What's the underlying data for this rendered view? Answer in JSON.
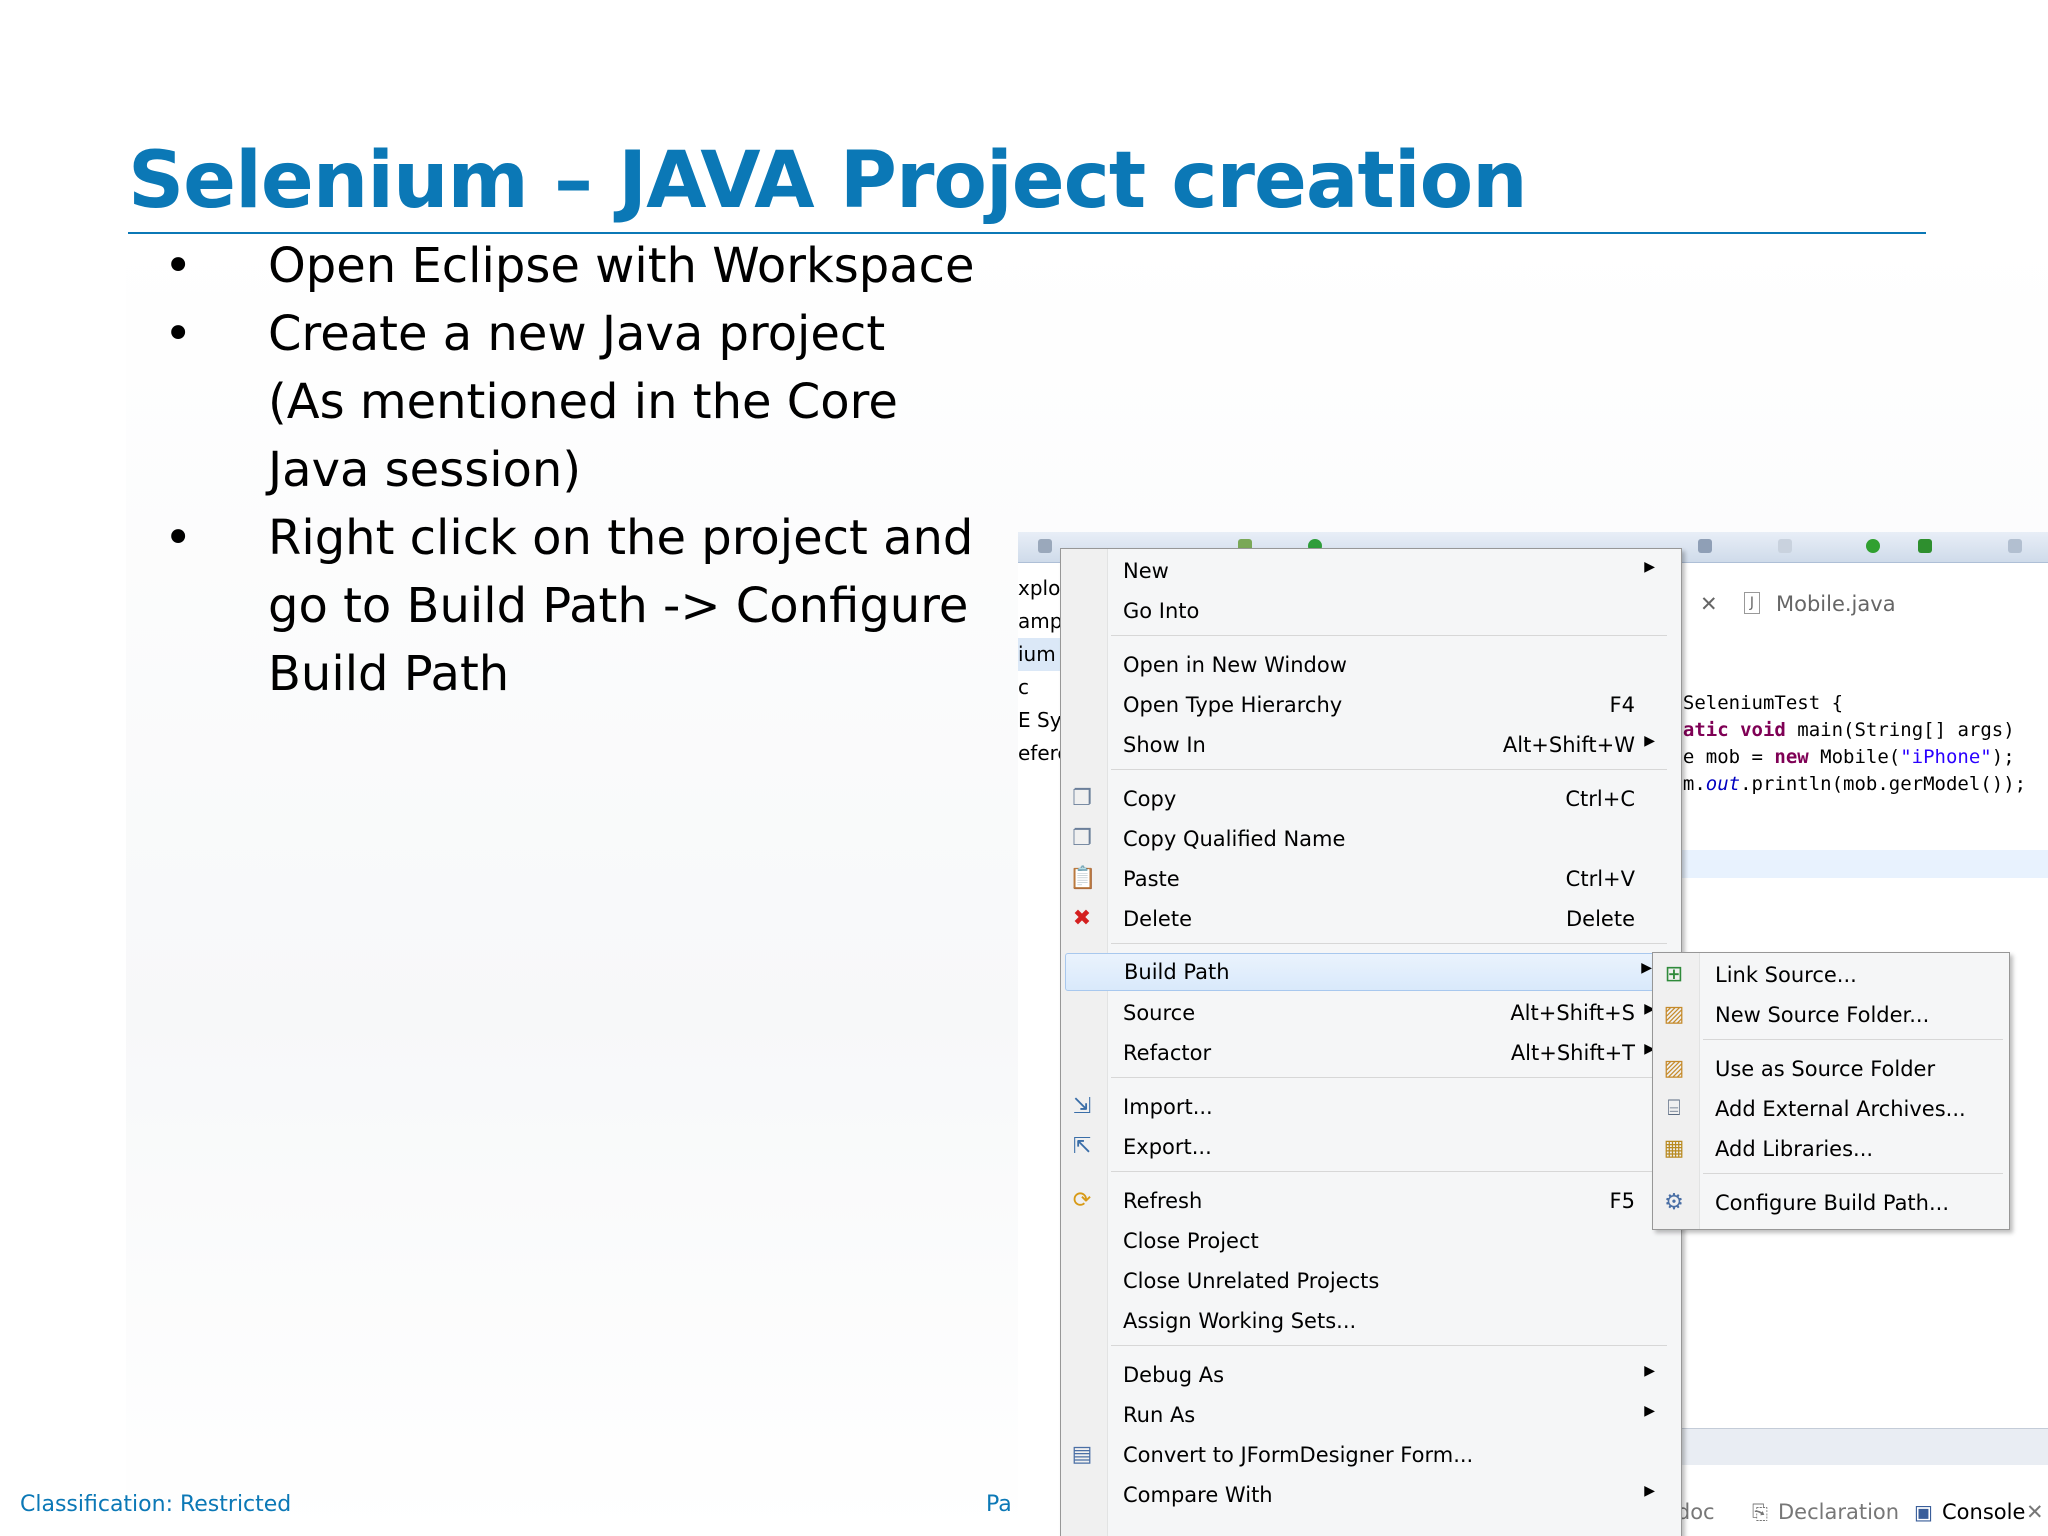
{
  "slide": {
    "title": "Selenium – JAVA Project creation",
    "bullets": [
      "Open Eclipse with Workspace",
      "Create a new Java project (As mentioned in the Core Java session)",
      "Right click on the project and go to Build Path -> Configure Build Path"
    ],
    "bullet_symbol": "•",
    "footer_classification": "Classification: Restricted",
    "footer_page": "Pa",
    "accent_color": "#0b78b6"
  },
  "eclipse": {
    "explorer_fragments": [
      "xplo",
      "amp",
      "ium",
      "c",
      "E Sy",
      "efere"
    ],
    "editor_tabs": [
      "Mobile.java"
    ],
    "code_lines": [
      {
        "text": ";"
      },
      {
        "text": ""
      },
      {
        "text": "s SeleniumTest {"
      },
      {
        "text": "static void main(String[] args)"
      },
      {
        "text": "ile mob = new Mobile(\"iPhone\");"
      },
      {
        "text": "tem.out.println(mob.gerModel());"
      }
    ],
    "bottom_tabs": [
      "adoc",
      "Declaration",
      "Console"
    ],
    "context_menu": {
      "items": [
        {
          "label": "New",
          "shortcut": "",
          "submenu": true
        },
        {
          "label": "Go Into",
          "shortcut": "",
          "submenu": false
        },
        {
          "label": "Open in New Window",
          "shortcut": "",
          "submenu": false
        },
        {
          "label": "Open Type Hierarchy",
          "shortcut": "F4",
          "submenu": false
        },
        {
          "label": "Show In",
          "shortcut": "Alt+Shift+W",
          "submenu": true
        },
        {
          "label": "Copy",
          "shortcut": "Ctrl+C",
          "submenu": false,
          "icon": "copy-icon"
        },
        {
          "label": "Copy Qualified Name",
          "shortcut": "",
          "submenu": false,
          "icon": "copy-qualified-icon"
        },
        {
          "label": "Paste",
          "shortcut": "Ctrl+V",
          "submenu": false,
          "icon": "paste-icon"
        },
        {
          "label": "Delete",
          "shortcut": "Delete",
          "submenu": false,
          "icon": "delete-icon"
        },
        {
          "label": "Build Path",
          "shortcut": "",
          "submenu": true,
          "highlighted": true
        },
        {
          "label": "Source",
          "shortcut": "Alt+Shift+S",
          "submenu": true
        },
        {
          "label": "Refactor",
          "shortcut": "Alt+Shift+T",
          "submenu": true
        },
        {
          "label": "Import...",
          "shortcut": "",
          "submenu": false,
          "icon": "import-icon"
        },
        {
          "label": "Export...",
          "shortcut": "",
          "submenu": false,
          "icon": "export-icon"
        },
        {
          "label": "Refresh",
          "shortcut": "F5",
          "submenu": false,
          "icon": "refresh-icon"
        },
        {
          "label": "Close Project",
          "shortcut": "",
          "submenu": false
        },
        {
          "label": "Close Unrelated Projects",
          "shortcut": "",
          "submenu": false
        },
        {
          "label": "Assign Working Sets...",
          "shortcut": "",
          "submenu": false
        },
        {
          "label": "Debug As",
          "shortcut": "",
          "submenu": true
        },
        {
          "label": "Run As",
          "shortcut": "",
          "submenu": true
        },
        {
          "label": "Convert to JFormDesigner Form...",
          "shortcut": "",
          "submenu": false,
          "icon": "jform-icon"
        },
        {
          "label": "Compare With",
          "shortcut": "",
          "submenu": true
        }
      ]
    },
    "build_path_submenu": {
      "items": [
        {
          "label": "Link Source...",
          "icon": "link-source-icon"
        },
        {
          "label": "New Source Folder...",
          "icon": "new-source-folder-icon"
        },
        {
          "label": "Use as Source Folder",
          "icon": "use-source-folder-icon"
        },
        {
          "label": "Add External Archives...",
          "icon": "archive-icon"
        },
        {
          "label": "Add Libraries...",
          "icon": "libraries-icon"
        },
        {
          "label": "Configure Build Path...",
          "icon": "configure-build-path-icon"
        }
      ]
    }
  }
}
